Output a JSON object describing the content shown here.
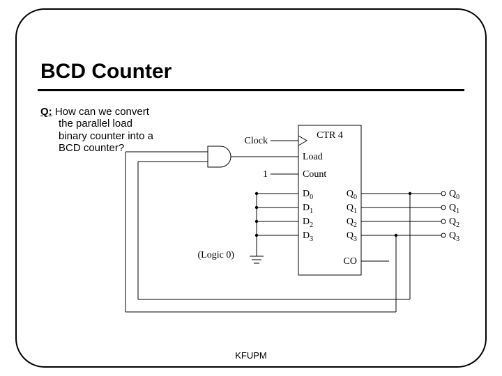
{
  "title": "BCD Counter",
  "question": {
    "prefix": "Q:",
    "line1": "How can we convert",
    "line2": "the parallel load",
    "line3": "binary counter into a",
    "line4": "BCD counter?"
  },
  "footer": "KFUPM",
  "diagram": {
    "block_label": "CTR 4",
    "clock": "Clock",
    "load": "Load",
    "count": "Count",
    "one": "1",
    "D": [
      "D",
      "D",
      "D",
      "D"
    ],
    "D_sub": [
      "0",
      "1",
      "2",
      "3"
    ],
    "Q": [
      "Q",
      "Q",
      "Q",
      "Q"
    ],
    "Q_sub": [
      "0",
      "1",
      "2",
      "3"
    ],
    "Qout": [
      "Q",
      "Q",
      "Q",
      "Q"
    ],
    "Qout_sub": [
      "0",
      "1",
      "2",
      "3"
    ],
    "CO": "CO",
    "logic0": "(Logic 0)"
  },
  "chart_data": {
    "type": "diagram",
    "description": "Parallel-load 4-bit counter (CTR 4) configured as a BCD counter",
    "signals": {
      "Clock": "external clock input",
      "Count": "tied to constant 1",
      "Load": "driven by AND of Q0 and Q3 (detects count = 1001, i.e., 9)",
      "D_inputs": [
        "D0=0",
        "D1=0",
        "D2=0",
        "D3=0"
      ],
      "D_tied_to": "Logic 0 (ground)",
      "Outputs": [
        "Q0",
        "Q1",
        "Q2",
        "Q3"
      ],
      "CO": "carry out (unused externally in figure)"
    },
    "gate": {
      "type": "AND",
      "inputs": [
        "Q0",
        "Q3"
      ],
      "output": "Load"
    }
  }
}
